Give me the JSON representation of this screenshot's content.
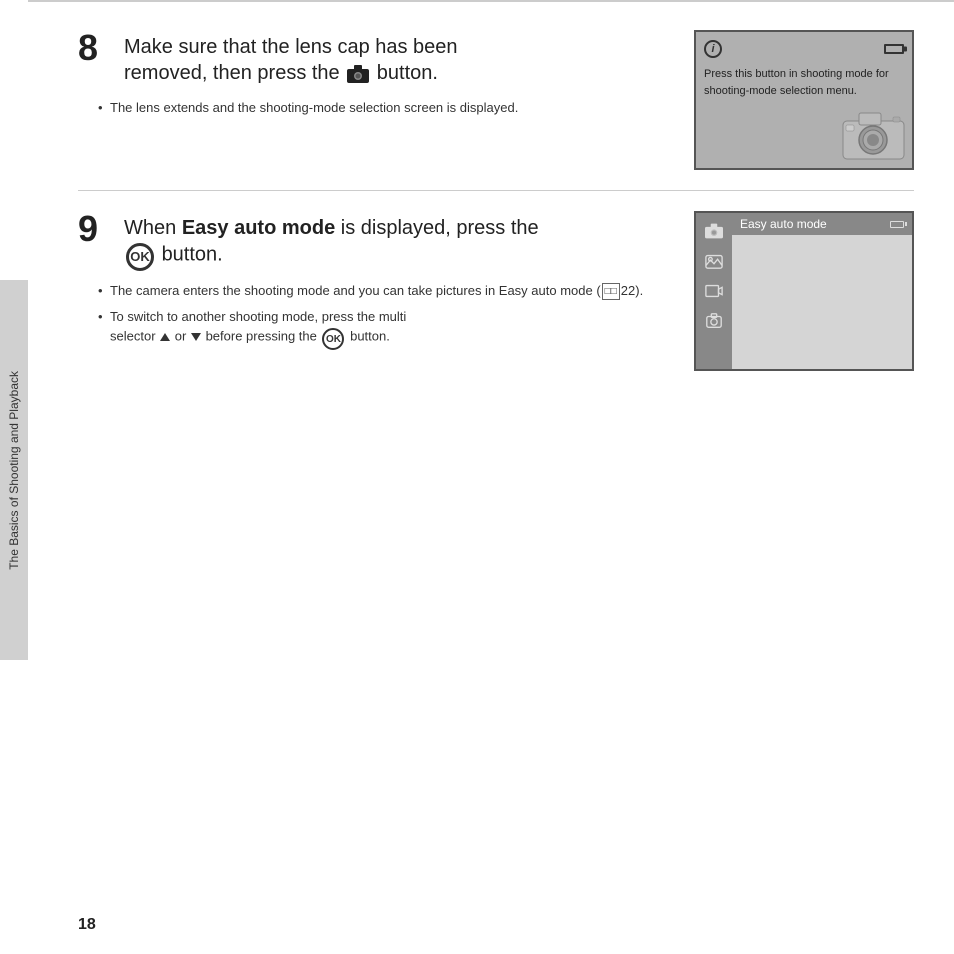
{
  "page": {
    "number": "18",
    "sidebar_text": "The Basics of Shooting and Playback"
  },
  "step8": {
    "number": "8",
    "title_part1": "Make sure that the lens cap has been\nremoved, then press the",
    "title_part2": "button.",
    "bullet1": "The lens extends and the shooting-mode selection screen is displayed.",
    "panel": {
      "info_symbol": "i",
      "text": "Press this button in shooting mode for shooting-mode selection menu."
    }
  },
  "step9": {
    "number": "9",
    "title_part1": "When ",
    "title_bold": "Easy auto mode",
    "title_part2": " is displayed, press the",
    "title_part3": "button.",
    "ok_label": "OK",
    "bullet1": "The camera enters the shooting mode and you can take pictures in Easy auto mode (",
    "bullet1_ref": "22",
    "bullet1_end": ").",
    "bullet2_part1": "To switch to another shooting mode, press the multi selector",
    "bullet2_part2": "or",
    "bullet2_part3": "before pressing the",
    "bullet2_end": "button.",
    "panel": {
      "easy_auto_mode_label": "Easy auto mode"
    }
  }
}
